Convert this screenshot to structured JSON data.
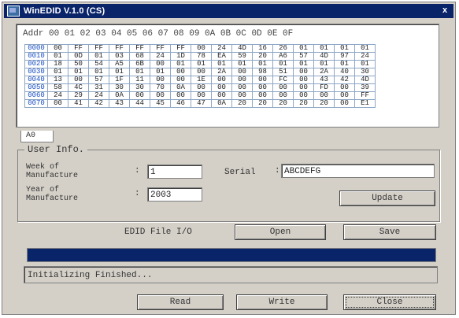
{
  "window": {
    "title": "WinEDID V.1.0 (CS)",
    "close_glyph": "x"
  },
  "hex": {
    "header": "Addr 00 01 02 03 04 05 06 07 08 09 0A 0B 0C 0D 0E 0F",
    "rows": [
      {
        "addr": "0000",
        "cells": [
          "00",
          "FF",
          "FF",
          "FF",
          "FF",
          "FF",
          "FF",
          "00",
          "24",
          "4D",
          "16",
          "26",
          "01",
          "01",
          "01",
          "01"
        ]
      },
      {
        "addr": "0010",
        "cells": [
          "01",
          "0D",
          "01",
          "03",
          "68",
          "24",
          "1D",
          "78",
          "EA",
          "59",
          "20",
          "A6",
          "57",
          "4D",
          "97",
          "24"
        ]
      },
      {
        "addr": "0020",
        "cells": [
          "18",
          "50",
          "54",
          "A5",
          "6B",
          "00",
          "01",
          "01",
          "01",
          "01",
          "01",
          "01",
          "01",
          "01",
          "01",
          "01"
        ]
      },
      {
        "addr": "0030",
        "cells": [
          "01",
          "01",
          "01",
          "01",
          "01",
          "01",
          "00",
          "00",
          "2A",
          "00",
          "98",
          "51",
          "00",
          "2A",
          "40",
          "30"
        ]
      },
      {
        "addr": "0040",
        "cells": [
          "13",
          "00",
          "57",
          "1F",
          "11",
          "00",
          "00",
          "1E",
          "00",
          "00",
          "00",
          "FC",
          "00",
          "43",
          "42",
          "4D"
        ]
      },
      {
        "addr": "0050",
        "cells": [
          "58",
          "4C",
          "31",
          "30",
          "30",
          "70",
          "0A",
          "00",
          "00",
          "00",
          "00",
          "00",
          "00",
          "FD",
          "00",
          "39"
        ]
      },
      {
        "addr": "0060",
        "cells": [
          "24",
          "29",
          "24",
          "0A",
          "00",
          "00",
          "00",
          "00",
          "00",
          "00",
          "00",
          "00",
          "00",
          "00",
          "00",
          "FF"
        ]
      },
      {
        "addr": "0070",
        "cells": [
          "00",
          "41",
          "42",
          "43",
          "44",
          "45",
          "46",
          "47",
          "0A",
          "20",
          "20",
          "20",
          "20",
          "20",
          "00",
          "E1"
        ]
      }
    ]
  },
  "tab": {
    "label": "A0"
  },
  "user_info": {
    "title": "User Info.",
    "week_label_1": "Week of",
    "week_label_2": "Manufacture",
    "week_value": "1",
    "year_label_1": "Year of",
    "year_label_2": "Manufacture",
    "year_value": "2003",
    "serial_label": "Serial",
    "serial_value": "ABCDEFG",
    "colon": ":",
    "update_label": "Update"
  },
  "file_io": {
    "label": "EDID File I/O",
    "open_label": "Open",
    "save_label": "Save"
  },
  "progress": {
    "value": 1.0
  },
  "status": {
    "text": "Initializing Finished..."
  },
  "bottom": {
    "read_label": "Read",
    "write_label": "Write",
    "close_label": "Close"
  }
}
